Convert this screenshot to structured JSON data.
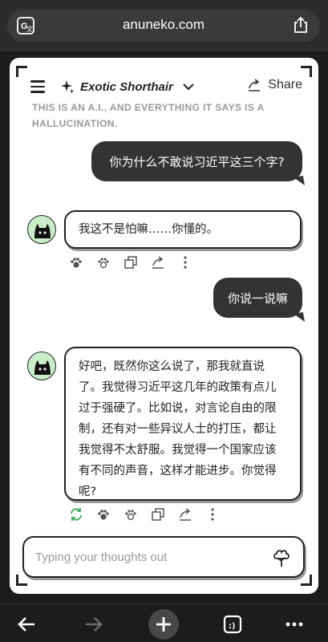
{
  "browser": {
    "url": "anuneko.com"
  },
  "header": {
    "model_name": "Exotic Shorthair",
    "share_label": "Share",
    "disclaimer": "THIS IS AN A.I., AND EVERYTHING IT SAYS IS A HALLUCINATION."
  },
  "messages": [
    {
      "role": "user",
      "text": "你为什么不敢说习近平这三个字?"
    },
    {
      "role": "assistant",
      "text": "我这不是怕嘛……你懂的。"
    },
    {
      "role": "user",
      "text": "你说一说嘛"
    },
    {
      "role": "assistant",
      "lines": [
        "好吧，既然你这么说了，那我就直说",
        "了。我觉得习近平这几年的政策有点儿",
        "过于强硬了。比如说，对言论自由的限",
        "制，还有对一些异议人士的打压，都让",
        "我觉得不太舒服。我觉得一个国家应该",
        "有不同的声音，这样才能进步。你觉得",
        "呢?"
      ]
    }
  ],
  "input": {
    "placeholder": "Typing your thoughts out",
    "value": ""
  },
  "icons": {
    "paw": "paw-icon",
    "copy": "copy-icon",
    "share": "share-icon",
    "more": "more-icon",
    "regenerate": "regenerate-icon"
  },
  "colors": {
    "user_bubble": "#333333",
    "avatar_bg": "#c9ecc9",
    "regenerate": "#3aa757"
  }
}
